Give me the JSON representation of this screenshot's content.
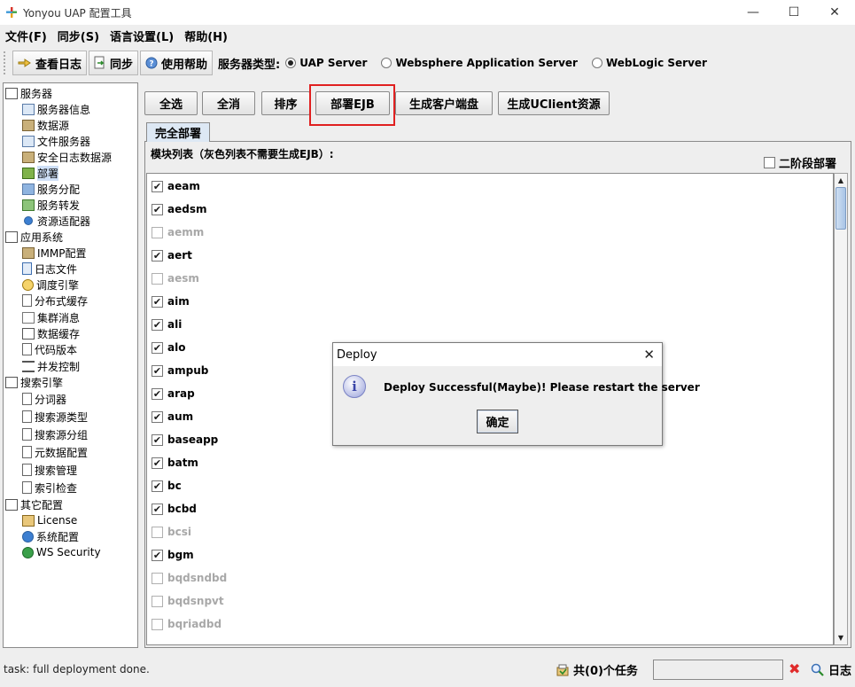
{
  "window": {
    "title": "Yonyou UAP 配置工具",
    "minimize": "—",
    "maximize": "☐",
    "close": "✕"
  },
  "menu": [
    "文件(F)",
    "同步(S)",
    "语言设置(L)",
    "帮助(H)"
  ],
  "toolbar": {
    "view_log": "查看日志",
    "sync": "同步",
    "help": "使用帮助",
    "server_type_label": "服务器类型:",
    "server_types": [
      {
        "label": "UAP Server",
        "selected": true
      },
      {
        "label": "Websphere Application Server",
        "selected": false
      },
      {
        "label": "WebLogic Server",
        "selected": false
      }
    ]
  },
  "tree": {
    "groups": [
      {
        "label": "服务器",
        "items": [
          {
            "label": "服务器信息",
            "icon": "monitor-icon"
          },
          {
            "label": "数据源",
            "icon": "datasource-icon"
          },
          {
            "label": "文件服务器",
            "icon": "monitor-icon"
          },
          {
            "label": "安全日志数据源",
            "icon": "datasource-icon"
          },
          {
            "label": "部署",
            "icon": "deploy-icon",
            "selected": true
          },
          {
            "label": "服务分配",
            "icon": "network-icon"
          },
          {
            "label": "服务转发",
            "icon": "network-icon"
          },
          {
            "label": "资源适配器",
            "icon": "dot-icon"
          }
        ]
      },
      {
        "label": "应用系统",
        "items": [
          {
            "label": "IMMP配置",
            "icon": "datasource-icon"
          },
          {
            "label": "日志文件",
            "icon": "log-file-icon"
          },
          {
            "label": "调度引擎",
            "icon": "clock-icon"
          },
          {
            "label": "分布式缓存",
            "icon": "document-icon"
          },
          {
            "label": "集群消息",
            "icon": "mail-icon"
          },
          {
            "label": "数据缓存",
            "icon": "table-icon"
          },
          {
            "label": "代码版本",
            "icon": "document-icon"
          },
          {
            "label": "并发控制",
            "icon": "list-icon"
          }
        ]
      },
      {
        "label": "搜索引擎",
        "items": [
          {
            "label": "分词器",
            "icon": "document-icon"
          },
          {
            "label": "搜索源类型",
            "icon": "document-icon"
          },
          {
            "label": "搜索源分组",
            "icon": "document-icon"
          },
          {
            "label": "元数据配置",
            "icon": "document-icon"
          },
          {
            "label": "搜索管理",
            "icon": "document-icon"
          },
          {
            "label": "索引检查",
            "icon": "document-icon"
          }
        ]
      },
      {
        "label": "其它配置",
        "items": [
          {
            "label": "License",
            "icon": "license-icon"
          },
          {
            "label": "系统配置",
            "icon": "system-config-icon"
          },
          {
            "label": "WS Security",
            "icon": "globe-icon"
          }
        ]
      }
    ]
  },
  "actions": {
    "select_all": "全选",
    "deselect_all": "全消",
    "sort": "排序",
    "deploy_ejb": "部署EJB",
    "gen_client_disk": "生成客户端盘",
    "gen_uclient": "生成UClient资源"
  },
  "tab": {
    "label": "完全部署"
  },
  "list": {
    "caption": "模块列表（灰色列表不需要生成EJB）:",
    "phase2_label": "二阶段部署",
    "modules": [
      {
        "name": "aeam",
        "checked": true,
        "disabled": false
      },
      {
        "name": "aedsm",
        "checked": true,
        "disabled": false
      },
      {
        "name": "aemm",
        "checked": false,
        "disabled": true
      },
      {
        "name": "aert",
        "checked": true,
        "disabled": false
      },
      {
        "name": "aesm",
        "checked": false,
        "disabled": true
      },
      {
        "name": "aim",
        "checked": true,
        "disabled": false
      },
      {
        "name": "ali",
        "checked": true,
        "disabled": false
      },
      {
        "name": "alo",
        "checked": true,
        "disabled": false
      },
      {
        "name": "ampub",
        "checked": true,
        "disabled": false
      },
      {
        "name": "arap",
        "checked": true,
        "disabled": false
      },
      {
        "name": "aum",
        "checked": true,
        "disabled": false
      },
      {
        "name": "baseapp",
        "checked": true,
        "disabled": false
      },
      {
        "name": "batm",
        "checked": true,
        "disabled": false
      },
      {
        "name": "bc",
        "checked": true,
        "disabled": false
      },
      {
        "name": "bcbd",
        "checked": true,
        "disabled": false
      },
      {
        "name": "bcsi",
        "checked": false,
        "disabled": true
      },
      {
        "name": "bgm",
        "checked": true,
        "disabled": false
      },
      {
        "name": "bqdsndbd",
        "checked": false,
        "disabled": true
      },
      {
        "name": "bqdsnpvt",
        "checked": false,
        "disabled": true
      },
      {
        "name": "bqriadbd",
        "checked": false,
        "disabled": true
      }
    ]
  },
  "dialog": {
    "title": "Deploy",
    "message": "Deploy Successful(Maybe)! Please restart the   server",
    "ok_label": "确定",
    "close": "✕",
    "info_glyph": "i"
  },
  "status": {
    "message": "task: full deployment done.",
    "tasks": "共(0)个任务",
    "log": "日志",
    "clear": "✖"
  },
  "scroll": {
    "up": "▲",
    "down": "▼"
  },
  "check_mark": "✔"
}
